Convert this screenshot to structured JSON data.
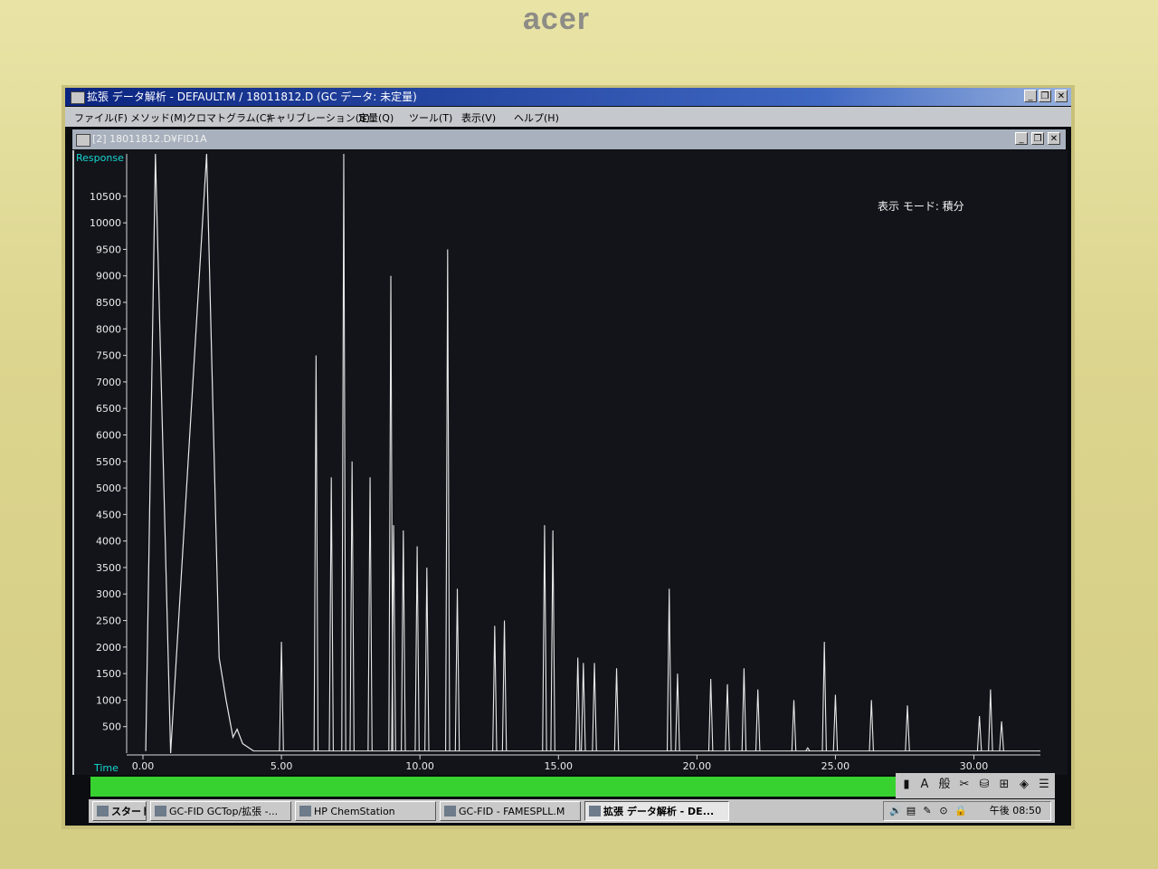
{
  "bezel": {
    "brand": "acer"
  },
  "window": {
    "title": "拡張 データ解析 - DEFAULT.M / 18011812.D   (GC データ: 未定量)",
    "controls": {
      "minimize": "_",
      "restore": "❐",
      "close": "✕"
    }
  },
  "menu": [
    "ファイル(F)",
    "メソッド(M)",
    "クロマトグラム(C)",
    "キャリブレーション(B)",
    "定量(Q)",
    "ツール(T)",
    "表示(V)",
    "ヘルプ(H)"
  ],
  "child_window": {
    "title": "[2] 18011812.D¥FID1A"
  },
  "annotation": {
    "display_mode": "表示 モード: 積分"
  },
  "chart_data": {
    "type": "line",
    "ylabel": "Response",
    "xlabel": "Time",
    "xlim": [
      0,
      32.4
    ],
    "ylim": [
      0,
      11300
    ],
    "y_ticks": [
      500,
      1000,
      1500,
      2000,
      2500,
      3000,
      3500,
      4000,
      4500,
      5000,
      5500,
      6000,
      6500,
      7000,
      7500,
      8000,
      8500,
      9000,
      9500,
      10000,
      10500
    ],
    "x_ticks": [
      {
        "value": 0,
        "label": "0.00"
      },
      {
        "value": 5,
        "label": "5.00"
      },
      {
        "value": 10,
        "label": "10.00"
      },
      {
        "value": 15,
        "label": "15.00"
      },
      {
        "value": 20,
        "label": "20.00"
      },
      {
        "value": 25,
        "label": "25.00"
      },
      {
        "value": 30,
        "label": "30.00"
      }
    ],
    "baseline": 40,
    "peaks": [
      {
        "t": 5.0,
        "h": 2100
      },
      {
        "t": 6.25,
        "h": 7500
      },
      {
        "t": 6.8,
        "h": 5200
      },
      {
        "t": 7.25,
        "h": 11300
      },
      {
        "t": 7.55,
        "h": 5500
      },
      {
        "t": 8.2,
        "h": 5200
      },
      {
        "t": 8.95,
        "h": 9000
      },
      {
        "t": 9.05,
        "h": 4300
      },
      {
        "t": 9.4,
        "h": 4200
      },
      {
        "t": 9.9,
        "h": 3900
      },
      {
        "t": 10.25,
        "h": 3500
      },
      {
        "t": 11.0,
        "h": 9500
      },
      {
        "t": 11.35,
        "h": 3100
      },
      {
        "t": 12.7,
        "h": 2400
      },
      {
        "t": 13.05,
        "h": 2500
      },
      {
        "t": 14.5,
        "h": 4300
      },
      {
        "t": 14.8,
        "h": 4200
      },
      {
        "t": 15.7,
        "h": 1800
      },
      {
        "t": 15.9,
        "h": 1700
      },
      {
        "t": 16.3,
        "h": 1700
      },
      {
        "t": 17.1,
        "h": 1600
      },
      {
        "t": 19.0,
        "h": 3100
      },
      {
        "t": 19.3,
        "h": 1500
      },
      {
        "t": 20.5,
        "h": 1400
      },
      {
        "t": 21.1,
        "h": 1300
      },
      {
        "t": 21.7,
        "h": 1600
      },
      {
        "t": 22.2,
        "h": 1200
      },
      {
        "t": 23.5,
        "h": 1000
      },
      {
        "t": 24.0,
        "h": 100
      },
      {
        "t": 24.6,
        "h": 2100
      },
      {
        "t": 25.0,
        "h": 1100
      },
      {
        "t": 26.3,
        "h": 1000
      },
      {
        "t": 27.6,
        "h": 900
      },
      {
        "t": 30.2,
        "h": 700
      },
      {
        "t": 30.6,
        "h": 1200
      },
      {
        "t": 31.0,
        "h": 600
      }
    ],
    "solvent_front": [
      {
        "t": 0.45,
        "h": 11300
      },
      {
        "t": 1.0,
        "h": 0
      },
      {
        "t": 2.3,
        "h": 11300
      },
      {
        "t": 2.75,
        "h": 1800
      },
      {
        "t": 3.0,
        "h": 1000
      },
      {
        "t": 3.25,
        "h": 300
      },
      {
        "t": 3.4,
        "h": 450
      },
      {
        "t": 3.6,
        "h": 180
      },
      {
        "t": 4.0,
        "h": 40
      }
    ],
    "line_color": "#e8e8e8",
    "axis_label_color": "#17d6d0"
  },
  "toolbar": {
    "tools": [
      "▮",
      "A",
      "般",
      "✂",
      "⛁",
      "⊞",
      "◈",
      "☰"
    ]
  },
  "taskbar": {
    "start": "スタート",
    "tasks": [
      {
        "label": "GC-FID GCTop/拡張 -...",
        "active": false
      },
      {
        "label": "HP ChemStation",
        "active": false
      },
      {
        "label": "GC-FID - FAMESPLL.M",
        "active": false
      },
      {
        "label": "拡張 データ解析 - DE...",
        "active": true
      }
    ],
    "tray_icons": [
      "🔊",
      "▤",
      "✎",
      "⊙",
      "🔒"
    ],
    "clock": "午後 08:50"
  }
}
